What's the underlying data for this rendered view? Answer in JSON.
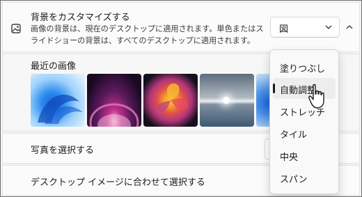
{
  "background": {
    "title": "背景をカスタマイズする",
    "description": "画像の背景は、現在のデスクトップに適用されます。単色またはスライドショーの背景は、すべてのデスクトップに適用されます。",
    "selected_type": "図"
  },
  "recent": {
    "label": "最近の画像"
  },
  "photo_row": {
    "label": "写真を選択する"
  },
  "fit_row": {
    "label": "デスクトップ イメージに合わせて選択する"
  },
  "fit_menu": {
    "options": [
      "塗りつぶし",
      "自動調整",
      "ストレッチ",
      "タイル",
      "中央",
      "スパン"
    ],
    "selected_index": 1
  },
  "icons": {
    "background": "image-icon",
    "dropdown": "chevron-down-icon",
    "collapse": "chevron-up-icon",
    "pointer": "mouse-cursor-icon"
  },
  "colors": {
    "selected_indicator": "#1b1b1b",
    "menu_background": "#f9f9f9"
  }
}
